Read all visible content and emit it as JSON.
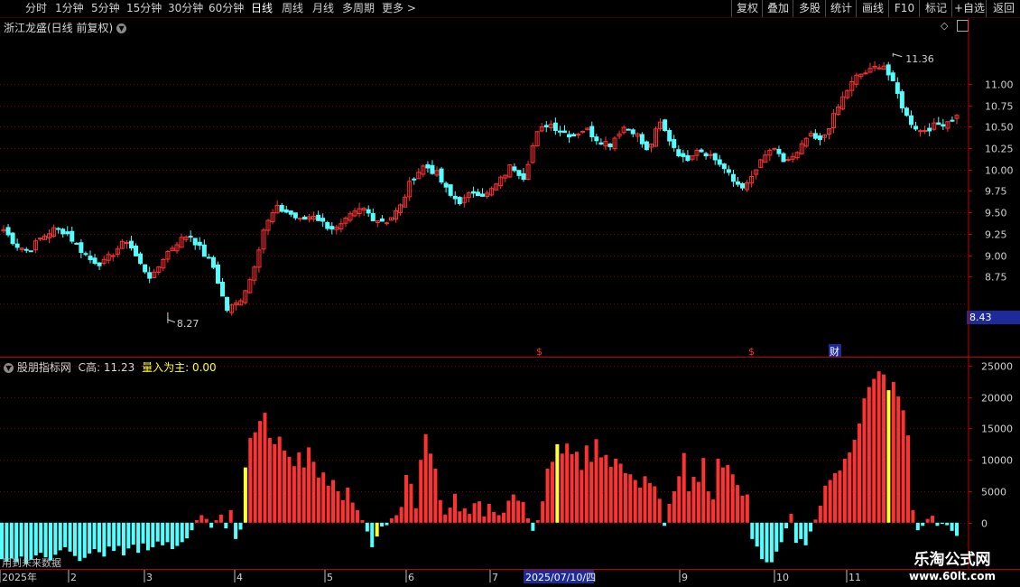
{
  "toolbar": {
    "periods": [
      "分时",
      "1分钟",
      "5分钟",
      "15分钟",
      "30分钟",
      "60分钟",
      "日线",
      "周线",
      "月线",
      "多周期",
      "更多 >"
    ],
    "active": "日线",
    "right": [
      "复权",
      "叠加",
      "多股",
      "统计",
      "画线",
      "F10",
      "标记",
      "+自选",
      "返回"
    ]
  },
  "price_panel": {
    "title": "浙江龙盛(日线 前复权)",
    "high_label": "11.36",
    "low_label": "8.27",
    "current_price": "8.43",
    "markers": [
      "$",
      "$",
      "财"
    ],
    "y_ticks": [
      "11.00",
      "10.75",
      "10.50",
      "10.25",
      "10.00",
      "9.75",
      "9.50",
      "9.25",
      "9.00",
      "8.75"
    ]
  },
  "indicator_panel": {
    "name": "股朋指标网",
    "c_high_label": "C高: 11.23",
    "main_label": "量入为主: 0.00",
    "y_ticks": [
      "25000",
      "20000",
      "15000",
      "10000",
      "5000",
      "0"
    ]
  },
  "time_axis": {
    "labels": [
      "2025年",
      "2",
      "3",
      "4",
      "5",
      "6",
      "7",
      "2025/07/10/四",
      "9",
      "10",
      "11"
    ],
    "overlay_note": "用到未来数据"
  },
  "watermark": {
    "line1": "乐淘公式网",
    "line2": "www.60lt.com"
  },
  "colors": {
    "up": "#ff3232",
    "down": "#54ffff",
    "signal": "#ffff33",
    "grid": "#7a0000",
    "axis": "#c00000",
    "crosshair": "#1d2b9a"
  },
  "chart_data": [
    {
      "type": "candlestick",
      "title": "浙江龙盛(日线 前复权)",
      "xlabel": "",
      "ylabel": "",
      "ylim": [
        8.1,
        11.6
      ],
      "x_labels": [
        "2025年",
        "2",
        "3",
        "4",
        "5",
        "6",
        "7",
        "2025/07/10/四",
        "9",
        "10",
        "11"
      ],
      "annotations": [
        {
          "text": "11.36",
          "type": "high"
        },
        {
          "text": "8.27",
          "type": "low"
        }
      ],
      "close_path": [
        9.3,
        9.12,
        9.05,
        9.2,
        9.3,
        9.28,
        9.1,
        8.95,
        8.9,
        9.05,
        9.18,
        8.9,
        8.72,
        9.0,
        9.15,
        9.25,
        9.05,
        8.85,
        8.36,
        8.45,
        8.75,
        9.3,
        9.55,
        9.5,
        9.4,
        9.48,
        9.35,
        9.3,
        9.45,
        9.55,
        9.42,
        9.4,
        9.55,
        9.9,
        10.05,
        9.95,
        9.7,
        9.62,
        9.75,
        9.7,
        9.85,
        10.05,
        9.92,
        10.4,
        10.55,
        10.45,
        10.4,
        10.48,
        10.35,
        10.3,
        10.5,
        10.45,
        10.2,
        10.55,
        10.3,
        10.1,
        10.25,
        10.18,
        10.05,
        9.85,
        9.8,
        10.05,
        10.25,
        10.1,
        10.15,
        10.4,
        10.32,
        10.6,
        10.9,
        11.1,
        11.15,
        11.25,
        10.95,
        10.6,
        10.45,
        10.5,
        10.55,
        10.62
      ]
    },
    {
      "type": "bar",
      "title": "股朋指标网",
      "xlabel": "",
      "ylabel": "",
      "ylim": [
        -6500,
        26000
      ],
      "series": [
        {
          "name": "量入为主",
          "values": [
            -5800,
            -6200,
            -5700,
            -6300,
            -5400,
            -6600,
            -5900,
            -5200,
            -4800,
            -5500,
            -6000,
            -5100,
            -4400,
            -3900,
            -4600,
            -5300,
            -6100,
            -5600,
            -4900,
            -4200,
            -4700,
            -5400,
            -3800,
            -4500,
            -3700,
            -5200,
            -4100,
            -3500,
            -4800,
            -3300,
            -4400,
            -3900,
            -3000,
            -3600,
            -3100,
            -4200,
            -3700,
            -3100,
            -2500,
            -1200,
            400,
            1200,
            600,
            -800,
            400,
            1300,
            -900,
            2000,
            -2600,
            -1100,
            8800,
            13500,
            14400,
            16200,
            17500,
            13500,
            12500,
            13700,
            11500,
            10500,
            9000,
            11200,
            8800,
            12000,
            9700,
            7200,
            8000,
            5900,
            6800,
            5000,
            3600,
            5600,
            3200,
            2000,
            400,
            -1400,
            -3900,
            -2200,
            -600,
            -400,
            700,
            1200,
            2500,
            7600,
            6200,
            2300,
            10000,
            14100,
            11000,
            8600,
            3600,
            1300,
            2400,
            4600,
            1800,
            2300,
            1400,
            3100,
            3400,
            1000,
            3000,
            1700,
            1200,
            1600,
            3500,
            4500,
            3500,
            3300,
            700,
            -1300,
            400,
            3400,
            8600,
            9700,
            12500,
            11000,
            12600,
            10900,
            11300,
            8400,
            12300,
            9700,
            13300,
            10400,
            10800,
            8900,
            10200,
            9400,
            7900,
            7700,
            6800,
            5600,
            7400,
            6300,
            5800,
            3800,
            -500,
            3000,
            5000,
            7400,
            11100,
            5000,
            7300,
            6500,
            10300,
            5000,
            3700,
            10200,
            8800,
            9200,
            7700,
            6000,
            4300,
            4500,
            -2600,
            -3800,
            -5800,
            -6300,
            -6300,
            -4600,
            -3100,
            -900,
            1400,
            -3200,
            -2600,
            -3600,
            -1400,
            500,
            2700,
            5900,
            6800,
            7900,
            8300,
            10200,
            11200,
            13200,
            15800,
            19800,
            21600,
            22900,
            24100,
            23600,
            21100,
            22400,
            20100,
            17900,
            13900,
            2000,
            -1200,
            -500,
            600,
            1100,
            -500,
            -200,
            -400,
            -1300,
            -2100
          ]
        }
      ]
    }
  ]
}
